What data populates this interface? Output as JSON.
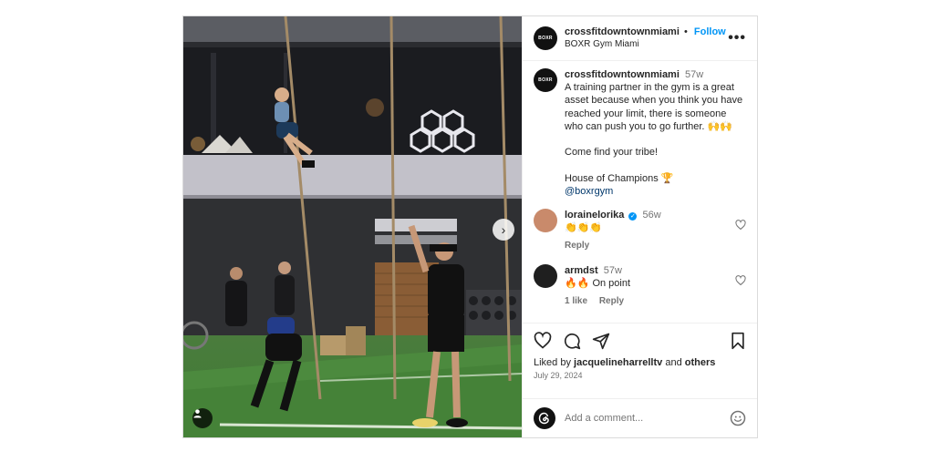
{
  "post": {
    "author": "crossfitdowntownmiami",
    "follow_label": "Follow",
    "separator": "•",
    "location": "BOXR Gym Miami",
    "more_label": "•••",
    "brand_avatar_text": "BOXR"
  },
  "caption": {
    "username": "crossfitdowntownmiami",
    "time": "57w",
    "text": "A training partner in the gym is a great asset because when you think you have reached your limit, there is someone who can push you to go further. 🙌🙌\n\nCome find your tribe!\n\nHouse of Champions 🏆",
    "mention": "@boxrgym"
  },
  "comments": [
    {
      "username": "lorainelorika",
      "verified": true,
      "verified_mark": "✓",
      "time": "56w",
      "text": "👏👏👏",
      "reply_label": "Reply",
      "avatar_color": "#c98a6b"
    },
    {
      "username": "armdst",
      "verified": false,
      "time": "57w",
      "text": "🔥🔥 On point",
      "likes_label": "1 like",
      "reply_label": "Reply",
      "avatar_color": "#1f1f1f"
    }
  ],
  "likes": {
    "prefix": "Liked by",
    "user": "jacquelineharrelltv",
    "middle": "and",
    "others": "others"
  },
  "date": "July 29, 2024",
  "composer": {
    "placeholder": "Add a comment...",
    "emoji_icon": "smiley-icon"
  },
  "icons": [
    "heart-icon",
    "comment-icon",
    "share-icon",
    "bookmark-icon",
    "chevron-right-icon",
    "user-tag-icon",
    "more-icon"
  ],
  "colors": {
    "accent": "#0095f6",
    "text": "#262626",
    "muted": "#737373",
    "border": "#dbdbdb"
  }
}
